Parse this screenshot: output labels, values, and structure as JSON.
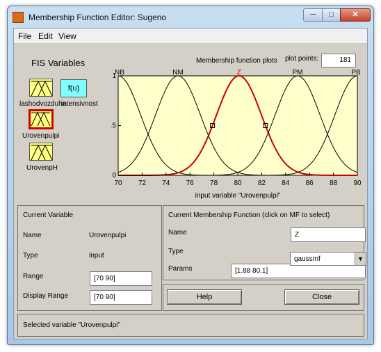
{
  "window": {
    "title": "Membership Function Editor: Sugeno",
    "minimize": "─",
    "maximize": "□",
    "close": "✕"
  },
  "menu": [
    "File",
    "Edit",
    "View"
  ],
  "fis": {
    "heading": "FIS Variables",
    "inputs": [
      "lashodvozduha",
      "Urovenpulpi",
      "UrovenpH"
    ],
    "output": "intensivnost",
    "output_symbol": "f(u)",
    "selected": "Urovenpulpi"
  },
  "plot": {
    "title": "Membership function plots",
    "points_label": "plot points:",
    "points": "181"
  },
  "chart_data": {
    "type": "line",
    "xlabel": "input variable \"Urovenpulpi\"",
    "xlim": [
      70,
      90
    ],
    "ylim": [
      0,
      1
    ],
    "xticks": [
      "70",
      "72",
      "74",
      "76",
      "78",
      "80",
      "82",
      "84",
      "86",
      "88",
      "90"
    ],
    "yticks": [
      "0",
      "0.5",
      "1"
    ],
    "mf_type": "gaussmf",
    "series": [
      {
        "name": "NB",
        "sigma": 1.88,
        "center": 70,
        "selected": false
      },
      {
        "name": "NM",
        "sigma": 1.88,
        "center": 75,
        "selected": false
      },
      {
        "name": "Z",
        "sigma": 1.88,
        "center": 80.1,
        "selected": true
      },
      {
        "name": "PM",
        "sigma": 1.88,
        "center": 85,
        "selected": false
      },
      {
        "name": "PB",
        "sigma": 1.88,
        "center": 90,
        "selected": false
      }
    ],
    "colors": {
      "background": "#ffffcc",
      "selected": "#cc0000",
      "normal": "#000000"
    }
  },
  "current_variable": {
    "heading": "Current Variable",
    "name_label": "Name",
    "name": "Urovenpulpi",
    "type_label": "Type",
    "type": "input",
    "range_label": "Range",
    "range": "[70 90]",
    "display_range_label": "Display Range",
    "display_range": "[70 90]"
  },
  "current_mf": {
    "heading": "Current Membership Function (click on MF to select)",
    "name_label": "Name",
    "name": "Z",
    "type_label": "Type",
    "type": "gaussmf",
    "params_label": "Params",
    "params": "[1.88 80.1]"
  },
  "buttons": {
    "help": "Help",
    "close": "Close"
  },
  "status": "Selected variable \"Urovenpulpi\""
}
